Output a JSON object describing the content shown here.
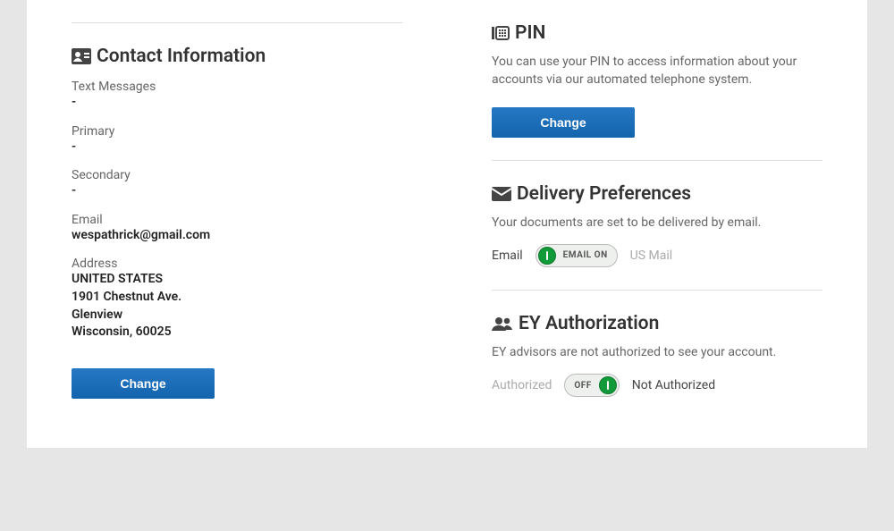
{
  "contact": {
    "heading": "Contact Information",
    "text_messages": {
      "label": "Text Messages",
      "value": "-"
    },
    "primary": {
      "label": "Primary",
      "value": "-"
    },
    "secondary": {
      "label": "Secondary",
      "value": "-"
    },
    "email": {
      "label": "Email",
      "value": "wespathrick@gmail.com"
    },
    "address": {
      "label": "Address",
      "country": "UNITED STATES",
      "street": "1901 Chestnut Ave.",
      "city": "Glenview",
      "state_zip": "Wisconsin, 60025"
    },
    "change_label": "Change"
  },
  "pin": {
    "heading": "PIN",
    "description": "You can use your PIN to access information about your accounts via our automated telephone system.",
    "change_label": "Change"
  },
  "delivery": {
    "heading": "Delivery Preferences",
    "description": "Your documents are set to be delivered by email.",
    "left_option": "Email",
    "toggle_text": "EMAIL ON",
    "right_option": "US Mail"
  },
  "ey": {
    "heading": "EY Authorization",
    "description": "EY advisors are not authorized to see your account.",
    "left_option": "Authorized",
    "toggle_text": "OFF",
    "right_option": "Not Authorized"
  }
}
